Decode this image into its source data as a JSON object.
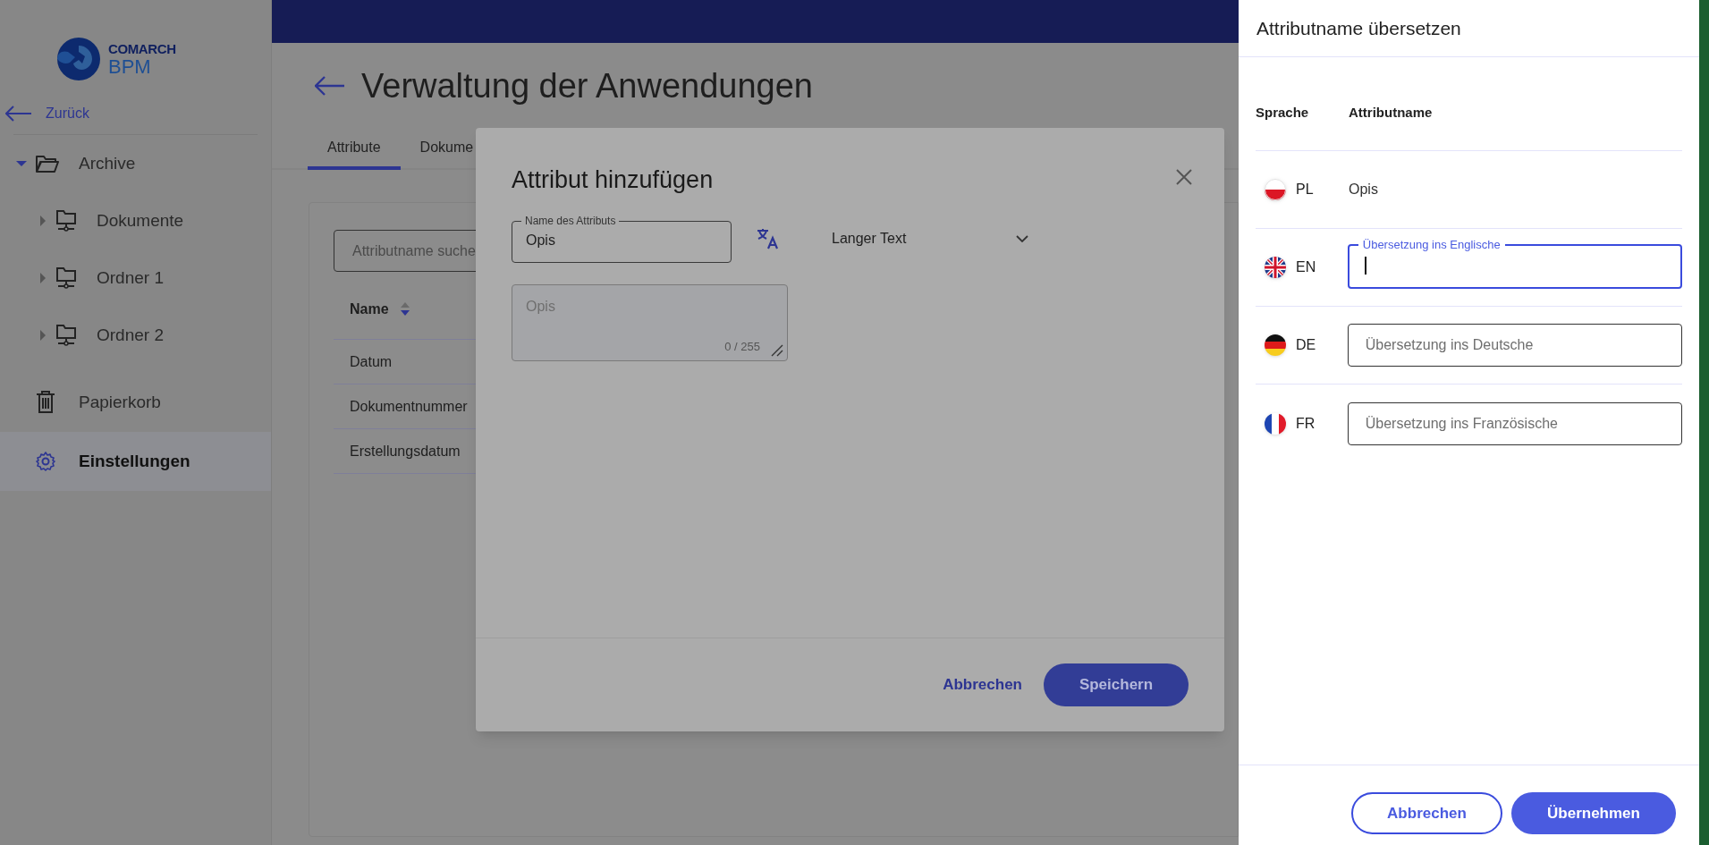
{
  "sidebar": {
    "logo": {
      "brand": "COMARCH",
      "product": "BPM"
    },
    "back": "Zurück",
    "tree": [
      {
        "label": "Archive",
        "expanded": true,
        "children": [
          {
            "label": "Dokumente",
            "expanded": false
          },
          {
            "label": "Ordner 1",
            "expanded": false
          },
          {
            "label": "Ordner 2",
            "expanded": false
          }
        ]
      }
    ],
    "nav": [
      {
        "label": "Papierkorb",
        "kind": "trash",
        "selected": false
      },
      {
        "label": "Einstellungen",
        "kind": "settings",
        "selected": true
      }
    ]
  },
  "page": {
    "title": "Verwaltung der Anwendungen",
    "tabs": [
      {
        "label": "Attribute",
        "selected": true
      },
      {
        "label": "Dokume",
        "selected": false
      }
    ],
    "search": {
      "placeholder": "Attributname suche"
    },
    "table": {
      "columns": [
        "Name"
      ],
      "rows": [
        "Datum",
        "Dokumentnummer",
        "Erstellungsdatum"
      ]
    }
  },
  "dialog": {
    "title": "Attribut hinzufügen",
    "name_field": {
      "label": "Name des Attributs",
      "value": "Opis"
    },
    "type_select": {
      "value": "Langer Text"
    },
    "description": {
      "placeholder": "Opis",
      "counter": "0 / 255"
    },
    "buttons": {
      "cancel": "Abbrechen",
      "save": "Speichern"
    }
  },
  "panel": {
    "title": "Attributname übersetzen",
    "columns": [
      "Sprache",
      "Attributname"
    ],
    "rows": [
      {
        "code": "PL",
        "flag": {
          "kind": "pl"
        },
        "kind": "text",
        "value": "Opis"
      },
      {
        "code": "EN",
        "flag": {
          "kind": "gb"
        },
        "kind": "field",
        "label": "Übersetzung ins Englische",
        "focused": true
      },
      {
        "code": "DE",
        "flag": {
          "kind": "de"
        },
        "kind": "field",
        "placeholder": "Übersetzung ins Deutsche",
        "focused": false
      },
      {
        "code": "FR",
        "flag": {
          "kind": "fr"
        },
        "kind": "field",
        "placeholder": "Übersetzung ins Französische",
        "focused": false
      }
    ],
    "buttons": {
      "cancel": "Abbrechen",
      "apply": "Übernehmen"
    }
  }
}
